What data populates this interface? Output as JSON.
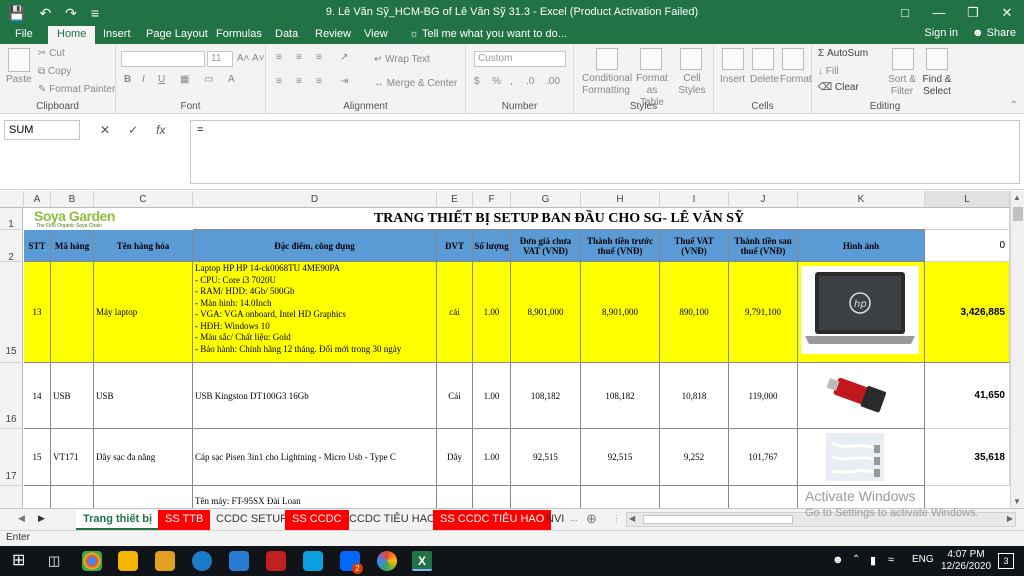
{
  "titlebar": {
    "title": "9. Lê Văn Sỹ_HCM-BG of Lê Văn Sỹ 31.3 - Excel (Product Activation Failed)"
  },
  "tabs": {
    "file": "File",
    "home": "Home",
    "insert": "Insert",
    "page_layout": "Page Layout",
    "formulas": "Formulas",
    "data": "Data",
    "review": "Review",
    "view": "View",
    "tell_me": "Tell me what you want to do...",
    "sign_in": "Sign in",
    "share": "Share"
  },
  "ribbon": {
    "paste": "Paste",
    "cut": "Cut",
    "copy": "Copy",
    "format_painter": "Format Painter",
    "clipboard": "Clipboard",
    "font_size": "11",
    "font": "Font",
    "wrap_text": "Wrap Text",
    "merge_center": "Merge & Center",
    "alignment": "Alignment",
    "number_format": "Custom",
    "number": "Number",
    "conditional_formatting": "Conditional Formatting",
    "format_as_table": "Format as Table",
    "cell_styles": "Cell Styles",
    "styles": "Styles",
    "insert": "Insert",
    "delete": "Delete",
    "format": "Format",
    "cells": "Cells",
    "autosum": "AutoSum",
    "fill": "Fill",
    "clear": "Clear",
    "sort_filter": "Sort & Filter",
    "find_select": "Find & Select",
    "editing": "Editing"
  },
  "formula": {
    "namebox": "SUM",
    "value": "="
  },
  "grid": {
    "columns": [
      "A",
      "B",
      "C",
      "D",
      "E",
      "F",
      "G",
      "H",
      "I",
      "J",
      "K",
      "L"
    ],
    "logo_name": "Soya Garden",
    "logo_tagline": "The First Organic Soya Chain",
    "title": "TRANG THIẾT BỊ SETUP BAN ĐẦU CHO SG- LÊ VĂN SỸ",
    "headers": [
      "STT",
      "Mã hàng",
      "Tên hàng hóa",
      "Đặc điểm, công dụng",
      "ĐVT",
      "Số lượng",
      "Đơn giá chưa VAT (VNĐ)",
      "Thành tiền trước thuế (VNĐ)",
      "Thuế VAT (VNĐ)",
      "Thành tiền sau thuế (VNĐ)",
      "Hình ảnh"
    ],
    "l2": "0",
    "rows": [
      {
        "row": "15",
        "stt": "13",
        "code": "",
        "name": "Máy laptop",
        "desc": "Laptop HP HP 14-ck0068TU 4ME90PA\n- CPU: Core i3 7020U\n- RAM/ HDD: 4Gb/ 500Gb\n- Màn hình: 14.0Inch\n- VGA: VGA onboard, Intel HD Graphics\n- HĐH: Windows 10\n- Màu sắc/ Chất liệu: Gold\n- Bảo hành: Chính hãng 12 tháng. Đổi mới trong 30 ngày",
        "unit": "cái",
        "qty": "1.00",
        "price": "8,901,000",
        "pretax": "8,901,000",
        "vat": "890,100",
        "total": "9,791,100",
        "l": "3,426,885"
      },
      {
        "row": "16",
        "stt": "14",
        "code": "USB",
        "name": "USB",
        "desc": "USB Kingston DT100G3 16Gb",
        "unit": "Cái",
        "qty": "1.00",
        "price": "108,182",
        "pretax": "108,182",
        "vat": "10,818",
        "total": "119,000",
        "l": "41,650"
      },
      {
        "row": "17",
        "stt": "15",
        "code": "VT171",
        "name": "Dây sạc đa năng",
        "desc": "Cáp sạc Pisen 3in1 cho Lightning - Micro Usb - Type C",
        "unit": "Dây",
        "qty": "1.00",
        "price": "92,515",
        "pretax": "92,515",
        "vat": "9,252",
        "total": "101,767",
        "l": "35,618"
      }
    ],
    "partial_desc": "Tên máy: FT-95SX Đài Loan"
  },
  "sheets": [
    "Trang thiết bị",
    "SS TTB",
    "CCDC SETUP",
    "SS CCDC",
    "CCDC TIÊU HAO",
    "SS CCDC TIÊU HAO",
    "NVI"
  ],
  "status": "Enter",
  "activation": {
    "title": "Activate Windows",
    "sub": "Go to Settings to activate Windows."
  },
  "taskbar": {
    "lang": "ENG",
    "time": "4:07 PM",
    "date": "12/26/2020",
    "badge": "2",
    "notify": "3"
  },
  "colors": {
    "excel_green": "#217346",
    "header_blue": "#5b9bd5",
    "highlight_yellow": "#ffff00",
    "tab_red": "#ff0000"
  }
}
